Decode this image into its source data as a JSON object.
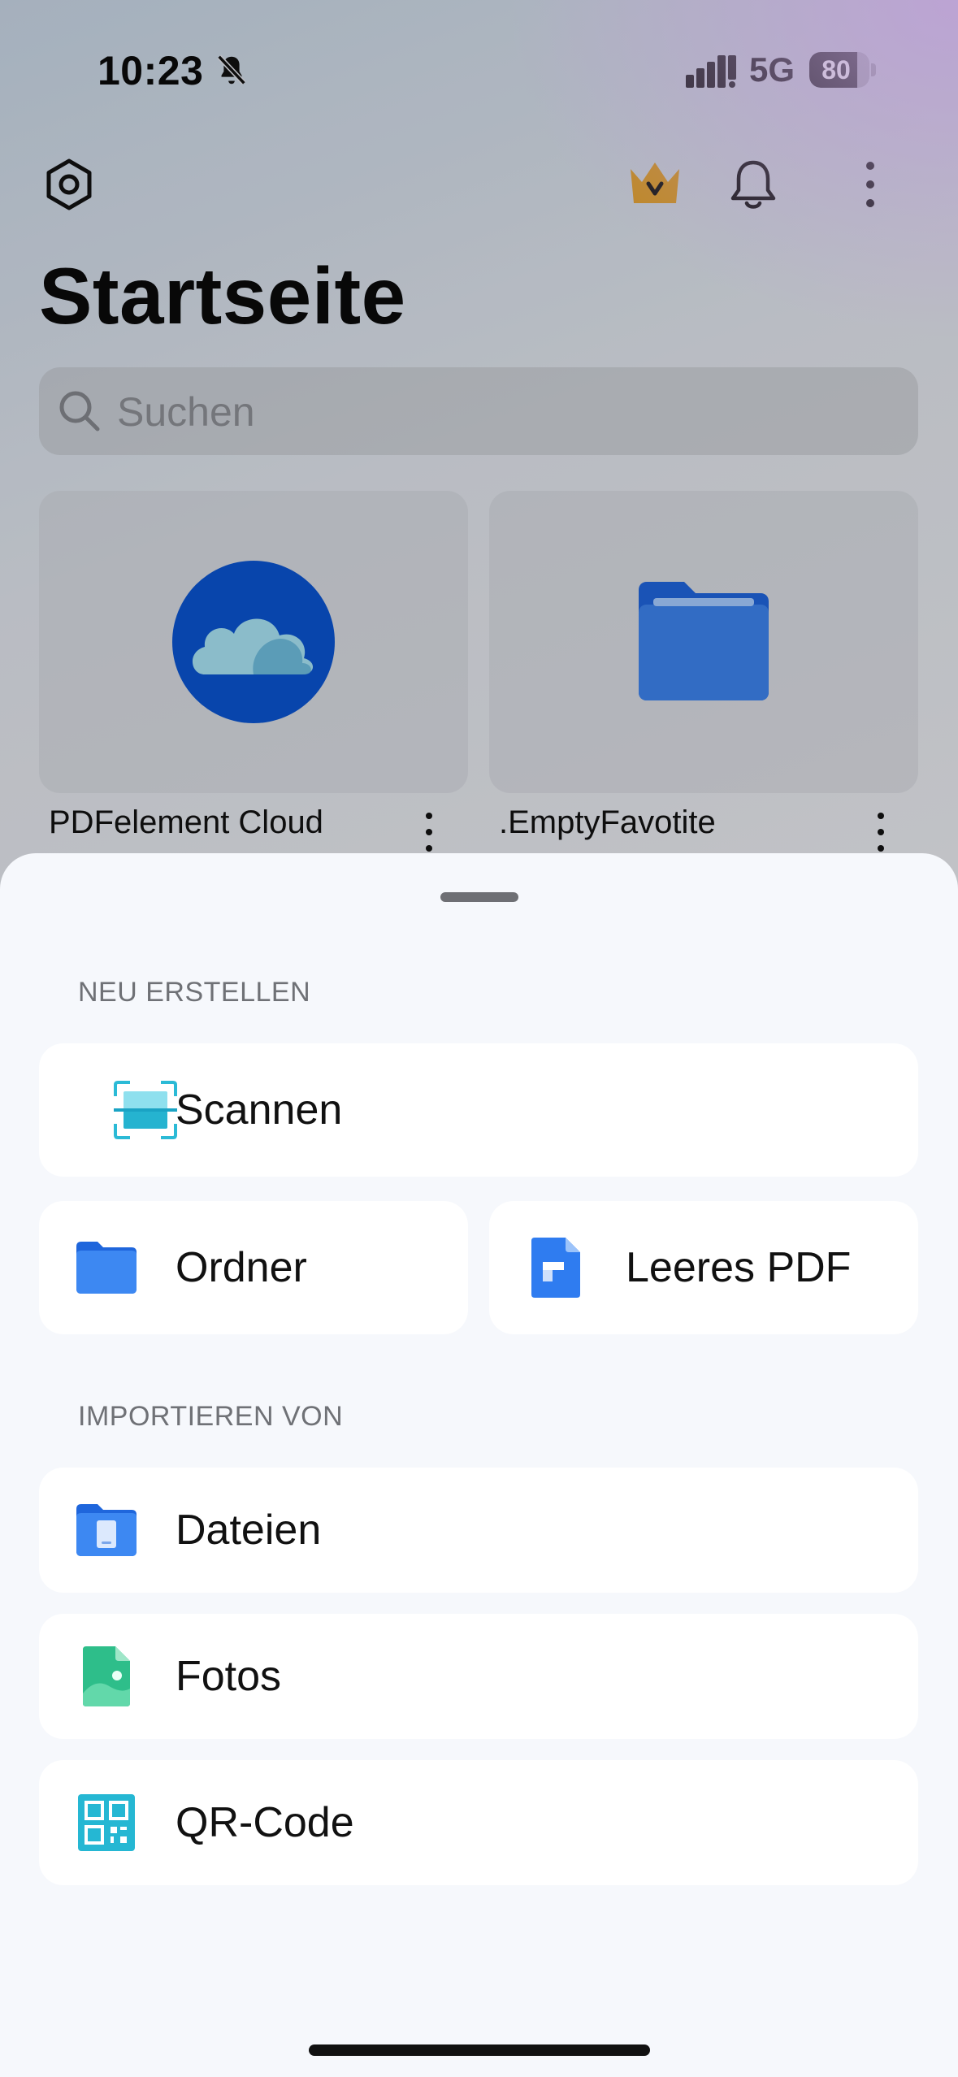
{
  "status_bar": {
    "time": "10:23",
    "network": "5G",
    "battery_percent": 80,
    "battery_label": "80",
    "icons": [
      "bell-slash-icon",
      "signal-icon"
    ]
  },
  "header": {
    "title": "Startseite",
    "icons": [
      "settings-hexagon-icon",
      "premium-crown-icon",
      "bell-icon",
      "more-vertical-icon"
    ],
    "accent_color": "#d99a2b"
  },
  "search": {
    "placeholder": "Suchen"
  },
  "cards": [
    {
      "label": "PDFelement Cloud",
      "icon": "cloud-icon"
    },
    {
      "label": ".EmptyFavotite",
      "icon": "folder-icon"
    }
  ],
  "sheet": {
    "section_new": "NEU ERSTELLEN",
    "section_import": "IMPORTIEREN VON",
    "create_items": [
      {
        "label": "Scannen",
        "icon": "scan-icon"
      },
      {
        "label": "Ordner",
        "icon": "folder-icon"
      },
      {
        "label": "Leeres PDF",
        "icon": "blank-pdf-icon"
      }
    ],
    "import_items": [
      {
        "label": "Dateien",
        "icon": "files-icon"
      },
      {
        "label": "Fotos",
        "icon": "photos-icon"
      },
      {
        "label": "QR-Code",
        "icon": "qr-code-icon"
      }
    ]
  },
  "colors": {
    "sheet_background": "#f6f8fc",
    "row_background": "#ffffff",
    "cloud_blue": "#0a4fc4",
    "folder_blue": "#2a72e6",
    "scan_teal": "#2bbad6",
    "photos_green": "#2ebe8a"
  }
}
